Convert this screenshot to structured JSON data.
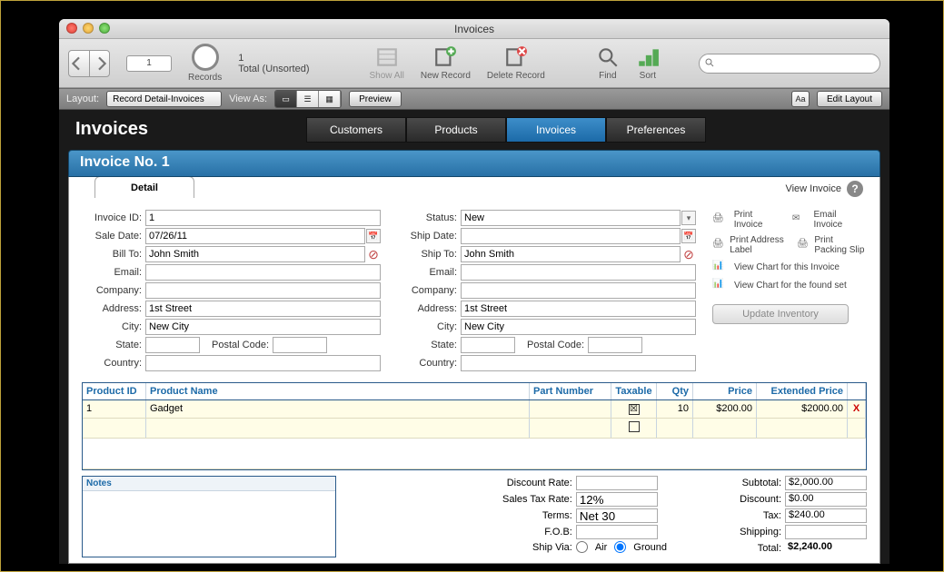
{
  "window_title": "Invoices",
  "toolbar": {
    "record_index": "1",
    "record_count": "1",
    "record_status": "Total (Unsorted)",
    "records_label": "Records",
    "show_all": "Show All",
    "new_record": "New Record",
    "delete_record": "Delete Record",
    "find": "Find",
    "sort": "Sort",
    "search_placeholder": ""
  },
  "statusbar": {
    "layout_label": "Layout:",
    "layout_value": "Record Detail-Invoices",
    "viewas_label": "View As:",
    "preview": "Preview",
    "edit_layout": "Edit Layout",
    "aa": "Aa"
  },
  "page_title": "Invoices",
  "tabs": [
    "Customers",
    "Products",
    "Invoices",
    "Preferences"
  ],
  "active_tab": "Invoices",
  "header": "Invoice No. 1",
  "detail_tab": "Detail",
  "view_invoice": "View Invoice",
  "bill": {
    "invoice_id_label": "Invoice ID:",
    "invoice_id": "1",
    "sale_date_label": "Sale Date:",
    "sale_date": "07/26/11",
    "bill_to_label": "Bill To:",
    "bill_to": "John Smith",
    "email_label": "Email:",
    "email": "",
    "company_label": "Company:",
    "company": "",
    "address_label": "Address:",
    "address": "1st Street",
    "city_label": "City:",
    "city": "New City",
    "state_label": "State:",
    "state": "",
    "postal_label": "Postal Code:",
    "postal": "",
    "country_label": "Country:",
    "country": ""
  },
  "ship": {
    "status_label": "Status:",
    "status": "New",
    "ship_date_label": "Ship Date:",
    "ship_date": "",
    "ship_to_label": "Ship To:",
    "ship_to": "John Smith",
    "email_label": "Email:",
    "email": "",
    "company_label": "Company:",
    "company": "",
    "address_label": "Address:",
    "address": "1st Street",
    "city_label": "City:",
    "city": "New City",
    "state_label": "State:",
    "state": "",
    "postal_label": "Postal Code:",
    "postal": "",
    "country_label": "Country:",
    "country": ""
  },
  "side": {
    "print_invoice": "Print Invoice",
    "email_invoice": "Email Invoice",
    "print_address": "Print Address Label",
    "print_packing": "Print Packing Slip",
    "chart_invoice": "View Chart for this Invoice",
    "chart_found": "View Chart for the found set",
    "update_inventory": "Update Inventory"
  },
  "columns": {
    "product_id": "Product ID",
    "product_name": "Product Name",
    "part_number": "Part Number",
    "taxable": "Taxable",
    "qty": "Qty",
    "price": "Price",
    "ext_price": "Extended Price"
  },
  "line1": {
    "product_id": "1",
    "product_name": "Gadget",
    "part_number": "",
    "taxable": "☒",
    "qty": "10",
    "price": "$200.00",
    "ext_price": "$2000.00",
    "delete": "X"
  },
  "notes_label": "Notes",
  "summary": {
    "discount_rate_label": "Discount Rate:",
    "discount_rate": "",
    "sales_tax_rate_label": "Sales Tax Rate:",
    "sales_tax_rate": "12%",
    "terms_label": "Terms:",
    "terms": "Net 30",
    "fob_label": "F.O.B:",
    "fob": "",
    "ship_via_label": "Ship Via:",
    "ship_air": "Air",
    "ship_ground": "Ground",
    "subtotal_label": "Subtotal:",
    "subtotal": "$2,000.00",
    "discount_label": "Discount:",
    "discount": "$0.00",
    "tax_label": "Tax:",
    "tax": "$240.00",
    "shipping_label": "Shipping:",
    "shipping": "",
    "total_label": "Total:",
    "total": "$2,240.00"
  }
}
